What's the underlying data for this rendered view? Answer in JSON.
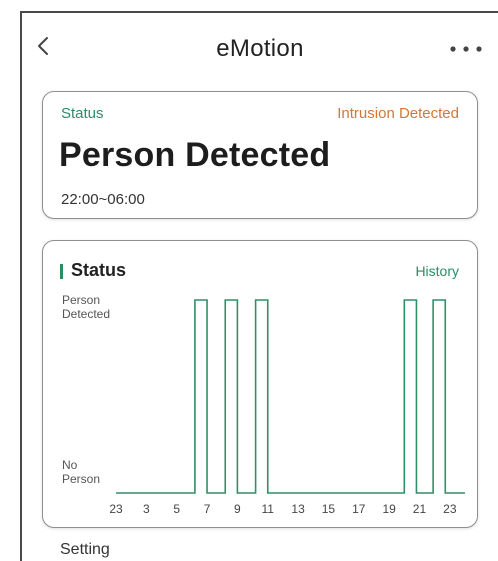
{
  "header": {
    "title": "eMotion",
    "back_icon": "chevron-left-icon",
    "more_icon": "more-horizontal-icon"
  },
  "status_card": {
    "label": "Status",
    "alert": "Intrusion Detected",
    "state": "Person Detected",
    "time_range": "22:00~06:00"
  },
  "chart_card": {
    "title": "Status",
    "history_label": "History"
  },
  "setting_label": "Setting",
  "colors": {
    "accent": "#2c8c63",
    "alert": "#d0773a",
    "line": "#2f8f68"
  },
  "chart_data": {
    "type": "line",
    "title": "Status",
    "step": true,
    "y_categories": [
      "No Person",
      "Person Detected"
    ],
    "y_tick_labels": [
      [
        "No",
        "Person"
      ],
      [
        "Person",
        "Detected"
      ]
    ],
    "x_ticks": [
      "23",
      "3",
      "5",
      "7",
      "9",
      "11",
      "13",
      "15",
      "17",
      "19",
      "21",
      "23"
    ],
    "series": [
      {
        "points": [
          [
            0,
            0
          ],
          [
            2.6,
            0
          ],
          [
            2.6,
            1
          ],
          [
            3.0,
            1
          ],
          [
            3.0,
            0
          ],
          [
            3.6,
            0
          ],
          [
            3.6,
            1
          ],
          [
            4.0,
            1
          ],
          [
            4.0,
            0
          ],
          [
            4.6,
            0
          ],
          [
            4.6,
            1
          ],
          [
            5.0,
            1
          ],
          [
            5.0,
            0
          ],
          [
            9.5,
            0
          ],
          [
            9.5,
            1
          ],
          [
            9.9,
            1
          ],
          [
            9.9,
            0
          ],
          [
            10.45,
            0
          ],
          [
            10.45,
            1
          ],
          [
            10.85,
            1
          ],
          [
            10.85,
            0
          ],
          [
            11.5,
            0
          ]
        ]
      }
    ],
    "xlim": [
      0,
      11.5
    ],
    "ylim": [
      0,
      1
    ],
    "grid": false,
    "legend": "none"
  }
}
